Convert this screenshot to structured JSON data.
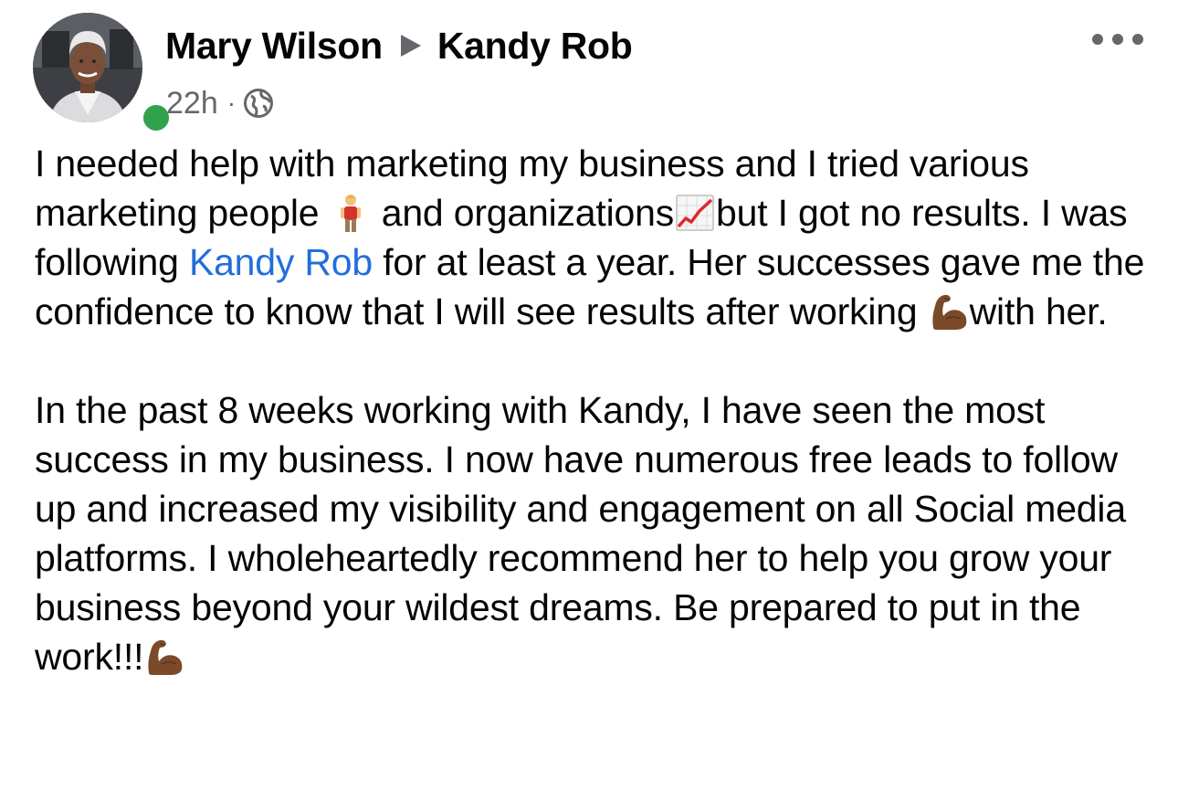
{
  "post": {
    "author_name": "Mary Wilson",
    "target_name": "Kandy Rob",
    "timestamp": "22h",
    "separator": "·",
    "privacy_icon": "globe-icon",
    "online_status_color": "#31a24c",
    "more_icon": "more-options-icon",
    "accent_link_color": "#216fdb",
    "paragraph1": {
      "s1": "I needed help with marketing my business and I tried various marketing people ",
      "emoji1": "person-emoji",
      "s2": " and organizations",
      "emoji2": "chart-increasing-emoji",
      "s3": "but I got no results. I was following ",
      "mention": "Kandy Rob",
      "s4": " for at least a year. Her successes gave me the confidence to know that I will see results after working ",
      "emoji3": "flexed-biceps-emoji",
      "s5": "with her."
    },
    "paragraph2": {
      "text": "In the past 8 weeks working with Kandy, I have seen the most success in my business.  I now have numerous free leads to follow up and increased my visibility and engagement on all Social media platforms.  I wholeheartedly recommend her to help you grow your business beyond your wildest dreams. Be prepared to put in the work!!!",
      "emoji": "flexed-biceps-emoji"
    }
  }
}
